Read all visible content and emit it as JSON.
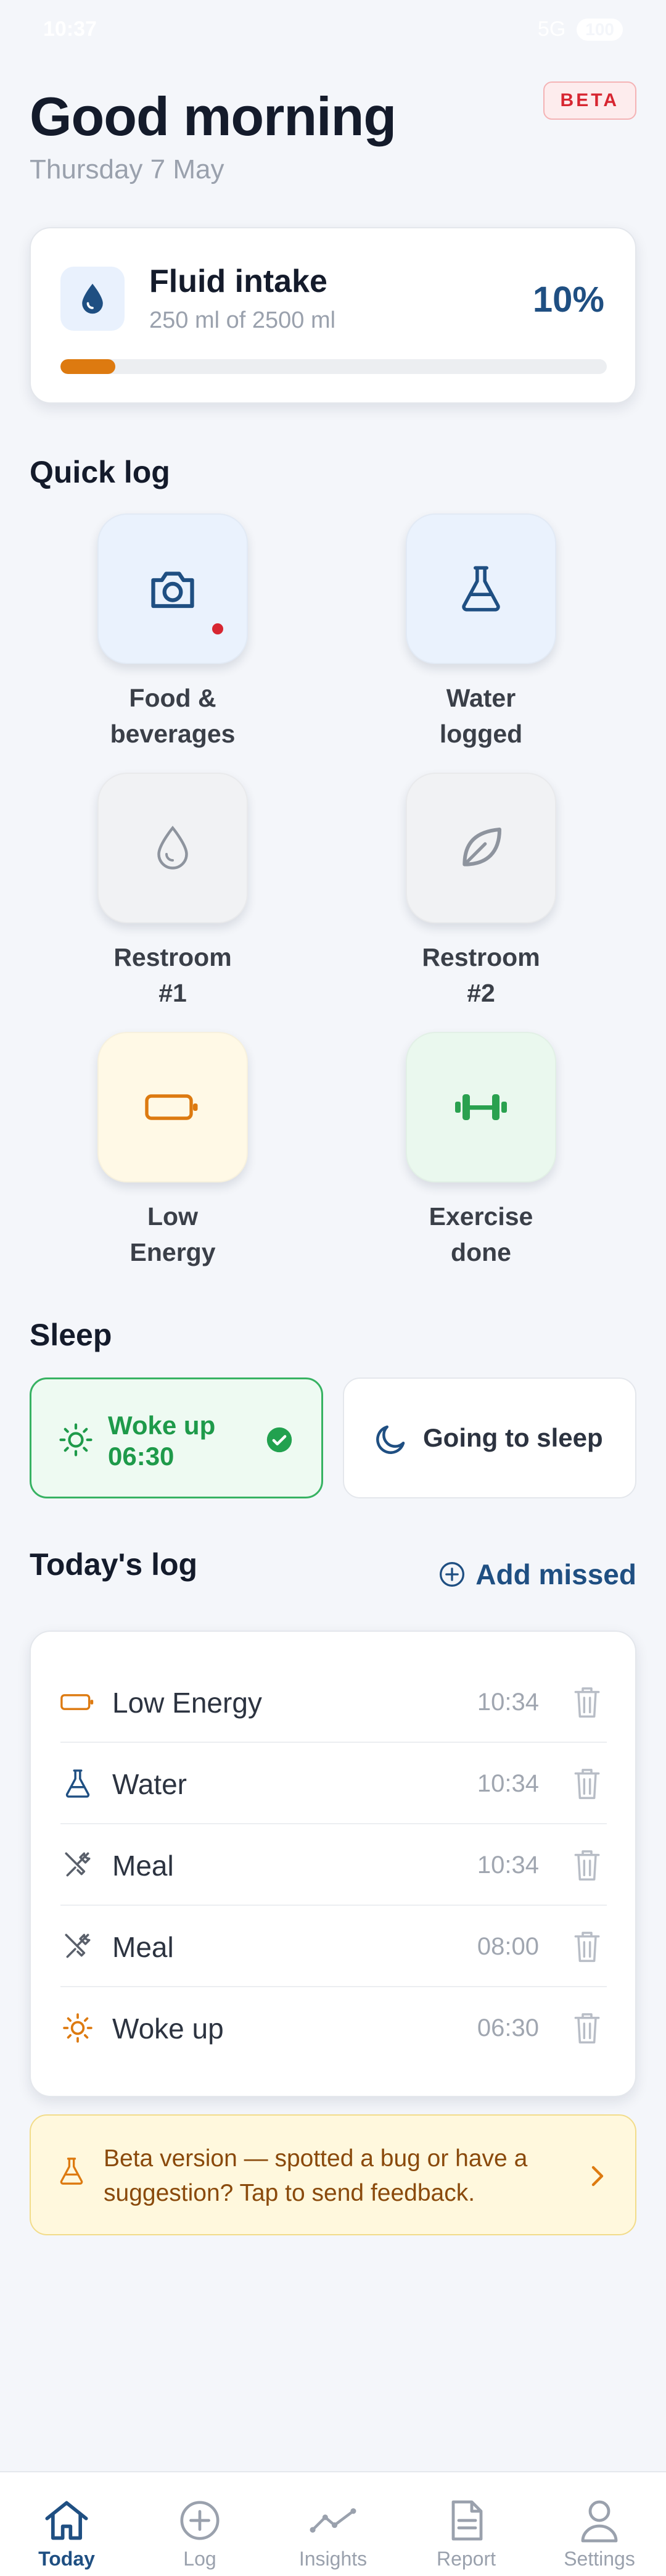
{
  "status_bar": {
    "time": "10:37",
    "network": "5G",
    "battery": "100"
  },
  "header": {
    "greeting": "Good morning",
    "date": "Thursday 7 May",
    "badge": "BETA"
  },
  "fluid": {
    "title": "Fluid intake",
    "subtitle": "250 ml of 2500 ml",
    "percent_label": "10%",
    "progress": 0.1,
    "accent_color": "#dd7a10"
  },
  "quick_log": {
    "title": "Quick log",
    "tiles": [
      {
        "label_line1": "Food &",
        "label_line2": "beverages",
        "icon": "camera-icon",
        "bg": "#eaf2fd",
        "has_dot": true
      },
      {
        "label_line1": "Water",
        "label_line2": "logged",
        "icon": "flask-icon",
        "bg": "#eaf2fd"
      },
      {
        "label_line1": "Restroom",
        "label_line2": "#1",
        "icon": "droplet-icon",
        "bg": "#f1f2f4"
      },
      {
        "label_line1": "Restroom",
        "label_line2": "#2",
        "icon": "leaf-icon",
        "bg": "#f1f2f4"
      },
      {
        "label_line1": "Low",
        "label_line2": "Energy",
        "icon": "battery-low-icon",
        "bg": "#fff9e6"
      },
      {
        "label_line1": "Exercise",
        "label_line2": "done",
        "icon": "dumbbell-icon",
        "bg": "#eaf8ee"
      }
    ]
  },
  "sleep": {
    "title": "Sleep",
    "woke_line1": "Woke up",
    "woke_line2": "06:30",
    "going_label": "Going to sleep"
  },
  "todays_log": {
    "title": "Today's log",
    "add_missed": "Add missed",
    "entries": [
      {
        "name": "Low Energy",
        "time": "10:34",
        "icon": "battery-low-icon"
      },
      {
        "name": "Water",
        "time": "10:34",
        "icon": "flask-icon"
      },
      {
        "name": "Meal",
        "time": "10:34",
        "icon": "utensils-icon"
      },
      {
        "name": "Meal",
        "time": "08:00",
        "icon": "utensils-icon"
      },
      {
        "name": "Woke up",
        "time": "06:30",
        "icon": "sun-icon"
      }
    ]
  },
  "feedback": {
    "text": "Beta version — spotted a bug or have a suggestion? Tap to send feedback."
  },
  "nav": {
    "items": [
      {
        "label": "Today",
        "icon": "home-icon",
        "active": true
      },
      {
        "label": "Log",
        "icon": "plus-circle-icon"
      },
      {
        "label": "Insights",
        "icon": "trend-icon"
      },
      {
        "label": "Report",
        "icon": "document-icon"
      },
      {
        "label": "Settings",
        "icon": "user-icon"
      }
    ]
  }
}
